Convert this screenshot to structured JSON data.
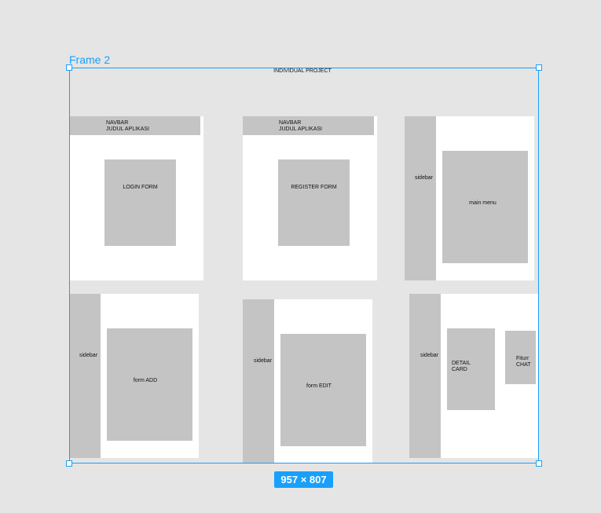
{
  "frame": {
    "name": "Frame 2",
    "title": "INDIVIDUAL PROJECT",
    "size": "957 × 807"
  },
  "screens": {
    "login": {
      "navbar_line1": "NAVBAR",
      "navbar_line2": "JUDUL APLIKASI",
      "form": "LOGIN FORM"
    },
    "register": {
      "navbar_line1": "NAVBAR",
      "navbar_line2": "JUDUL APLIKASI",
      "form": "REGISTER FORM"
    },
    "main_menu": {
      "sidebar": "sidebar",
      "content": "main menu"
    },
    "form_add": {
      "sidebar": "sidebar",
      "content": "form ADD"
    },
    "form_edit": {
      "sidebar": "sidebar",
      "content": "form EDIT"
    },
    "detail": {
      "sidebar": "sidebar",
      "card_line1": "DETAIL",
      "card_line2": "CARD",
      "chat_line1": "Fiturr",
      "chat_line2": "CHAT"
    }
  },
  "colors": {
    "selection": "#18a0fb",
    "canvas": "#e5e5e5",
    "placeholder": "#c4c4c4",
    "screen": "#ffffff"
  }
}
